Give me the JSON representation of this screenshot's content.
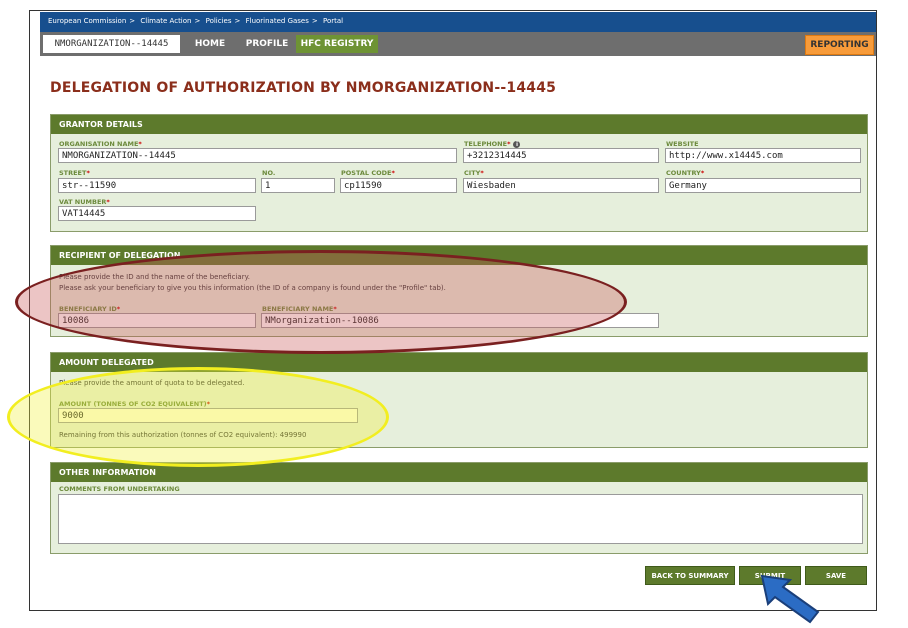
{
  "breadcrumb": [
    "European Commission",
    "Climate Action",
    "Policies",
    "Fluorinated Gases",
    "Portal"
  ],
  "breadcrumb_sep": ">",
  "nav": {
    "org_tab": "NMORGANIZATION--14445",
    "home": "HOME",
    "profile": "PROFILE",
    "hfc_registry": "HFC REGISTRY",
    "reporting": "REPORTING"
  },
  "page_title": "DELEGATION OF AUTHORIZATION BY NMORGANIZATION--14445",
  "grantor": {
    "header": "GRANTOR DETAILS",
    "org_name_label": "ORGANISATION NAME",
    "org_name": "NMORGANIZATION--14445",
    "telephone_label": "TELEPHONE",
    "telephone": "+3212314445",
    "website_label": "WEBSITE",
    "website": "http://www.x14445.com",
    "street_label": "STREET",
    "street": "str--11590",
    "no_label": "NO.",
    "no": "1",
    "postal_label": "POSTAL CODE",
    "postal": "cp11590",
    "city_label": "CITY",
    "city": "Wiesbaden",
    "country_label": "COUNTRY",
    "country": "Germany",
    "vat_label": "VAT NUMBER",
    "vat": "VAT14445",
    "required_mark": "*"
  },
  "recipient": {
    "header": "RECIPIENT OF DELEGATION",
    "note1": "Please provide the ID and the name of the beneficiary.",
    "note2": "Please ask your beneficiary to give you this information (the ID of a company is found under the \"Profile\" tab).",
    "id_label": "BENEFICIARY ID",
    "id": "10086",
    "name_label": "BENEFICIARY NAME",
    "name": "NMorganization--10086"
  },
  "amount": {
    "header": "AMOUNT DELEGATED",
    "note": "Please provide the amount of quota to be delegated.",
    "label": "AMOUNT (TONNES OF CO2 EQUIVALENT)",
    "value": "9000",
    "remaining": "Remaining from this authorization (tonnes of CO2 equivalent): 499990"
  },
  "other": {
    "header": "OTHER INFORMATION",
    "comments_label": "COMMENTS FROM UNDERTAKING",
    "comments": ""
  },
  "buttons": {
    "back": "BACK TO SUMMARY",
    "submit": "SUBMIT",
    "save": "SAVE"
  },
  "colors": {
    "header_green": "#5d7a2c",
    "title_red": "#8b2e1b",
    "topbar_blue": "#174f8e",
    "annotation_red": "#7a2020",
    "annotation_yellow": "#f2ee20",
    "arrow_blue": "#2b6cc4"
  },
  "icons": {
    "telephone_info": "info-icon",
    "pointer_arrow": "arrow-icon"
  }
}
